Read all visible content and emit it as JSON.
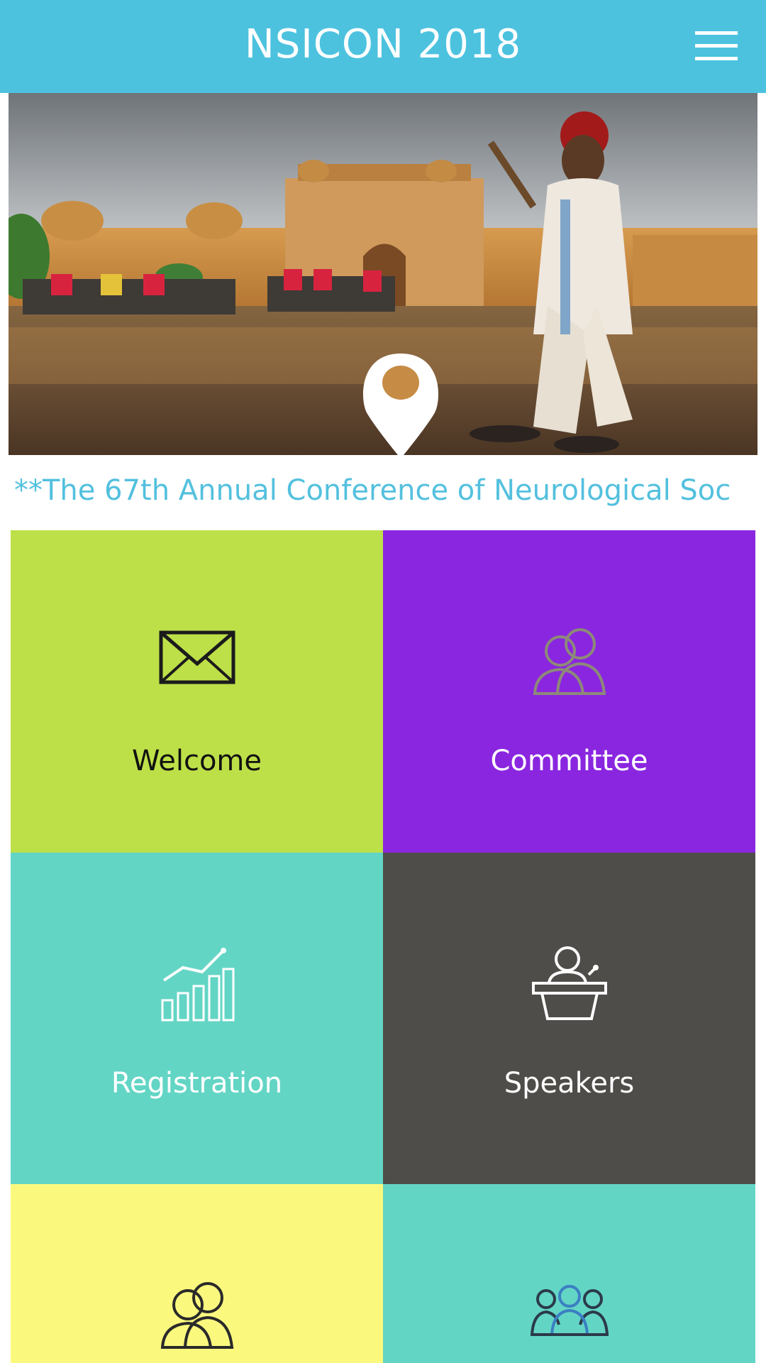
{
  "app": {
    "title": "NSICON 2018"
  },
  "ticker": {
    "text": "**The 67th Annual Conference of Neurological Soc"
  },
  "tiles": [
    {
      "label": "Welcome",
      "icon": "envelope-icon",
      "bg": "#bde048",
      "fg": "#111111"
    },
    {
      "label": "Committee",
      "icon": "people-icon",
      "bg": "#8a26e0",
      "fg": "#ffffff"
    },
    {
      "label": "Registration",
      "icon": "growth-chart-icon",
      "bg": "#63d5c5",
      "fg": "#ffffff"
    },
    {
      "label": "Speakers",
      "icon": "speaker-podium-icon",
      "bg": "#4f4d49",
      "fg": "#ffffff"
    },
    {
      "label": "",
      "icon": "people-icon",
      "bg": "#faf97e",
      "fg": "#111111"
    },
    {
      "label": "",
      "icon": "group-icon",
      "bg": "#63d5c5",
      "fg": "#ffffff"
    }
  ],
  "colors": {
    "appbar": "#4cc2df",
    "ticker_text": "#53c0de"
  }
}
